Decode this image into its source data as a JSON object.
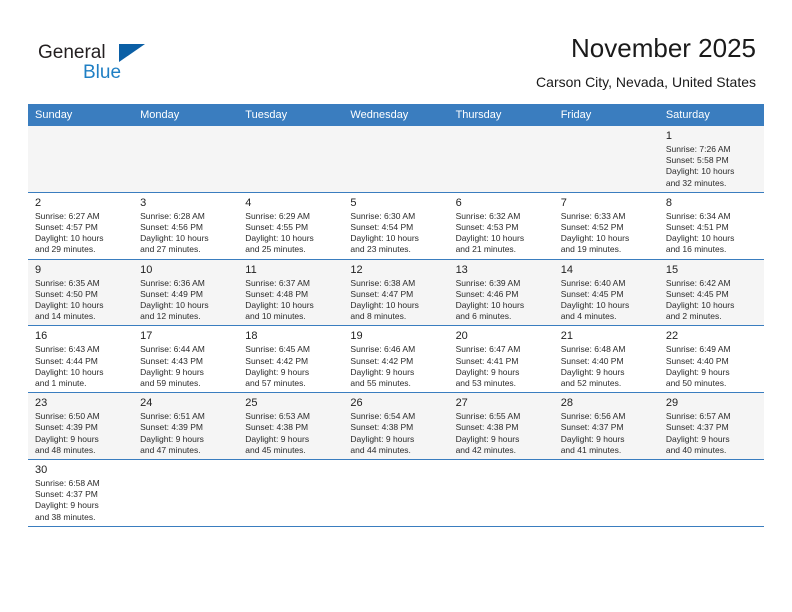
{
  "brand": {
    "name_top": "General",
    "name_bottom": "Blue",
    "accent_color": "#0b5fa5",
    "text_color": "#231f20",
    "blue_text_color": "#1f7fc4",
    "triangle_icon": "triangle-icon"
  },
  "header": {
    "title": "November 2025",
    "location": "Carson City, Nevada, United States"
  },
  "theme": {
    "header_row_bg": "#3a7dbf",
    "header_row_text": "#ffffff",
    "alt_row_bg": "#f5f5f5",
    "row_divider": "#3a7dbf"
  },
  "weekdays": [
    "Sunday",
    "Monday",
    "Tuesday",
    "Wednesday",
    "Thursday",
    "Friday",
    "Saturday"
  ],
  "labels": {
    "sunrise_prefix": "Sunrise:",
    "sunset_prefix": "Sunset:",
    "daylight_prefix": "Daylight:"
  },
  "weeks": [
    [
      {
        "empty": true
      },
      {
        "empty": true
      },
      {
        "empty": true
      },
      {
        "empty": true
      },
      {
        "empty": true
      },
      {
        "empty": true
      },
      {
        "day": "1",
        "sunrise": "Sunrise: 7:26 AM",
        "sunset": "Sunset: 5:58 PM",
        "daylight_line1": "Daylight: 10 hours",
        "daylight_line2": "and 32 minutes."
      }
    ],
    [
      {
        "day": "2",
        "sunrise": "Sunrise: 6:27 AM",
        "sunset": "Sunset: 4:57 PM",
        "daylight_line1": "Daylight: 10 hours",
        "daylight_line2": "and 29 minutes."
      },
      {
        "day": "3",
        "sunrise": "Sunrise: 6:28 AM",
        "sunset": "Sunset: 4:56 PM",
        "daylight_line1": "Daylight: 10 hours",
        "daylight_line2": "and 27 minutes."
      },
      {
        "day": "4",
        "sunrise": "Sunrise: 6:29 AM",
        "sunset": "Sunset: 4:55 PM",
        "daylight_line1": "Daylight: 10 hours",
        "daylight_line2": "and 25 minutes."
      },
      {
        "day": "5",
        "sunrise": "Sunrise: 6:30 AM",
        "sunset": "Sunset: 4:54 PM",
        "daylight_line1": "Daylight: 10 hours",
        "daylight_line2": "and 23 minutes."
      },
      {
        "day": "6",
        "sunrise": "Sunrise: 6:32 AM",
        "sunset": "Sunset: 4:53 PM",
        "daylight_line1": "Daylight: 10 hours",
        "daylight_line2": "and 21 minutes."
      },
      {
        "day": "7",
        "sunrise": "Sunrise: 6:33 AM",
        "sunset": "Sunset: 4:52 PM",
        "daylight_line1": "Daylight: 10 hours",
        "daylight_line2": "and 19 minutes."
      },
      {
        "day": "8",
        "sunrise": "Sunrise: 6:34 AM",
        "sunset": "Sunset: 4:51 PM",
        "daylight_line1": "Daylight: 10 hours",
        "daylight_line2": "and 16 minutes."
      }
    ],
    [
      {
        "day": "9",
        "sunrise": "Sunrise: 6:35 AM",
        "sunset": "Sunset: 4:50 PM",
        "daylight_line1": "Daylight: 10 hours",
        "daylight_line2": "and 14 minutes."
      },
      {
        "day": "10",
        "sunrise": "Sunrise: 6:36 AM",
        "sunset": "Sunset: 4:49 PM",
        "daylight_line1": "Daylight: 10 hours",
        "daylight_line2": "and 12 minutes."
      },
      {
        "day": "11",
        "sunrise": "Sunrise: 6:37 AM",
        "sunset": "Sunset: 4:48 PM",
        "daylight_line1": "Daylight: 10 hours",
        "daylight_line2": "and 10 minutes."
      },
      {
        "day": "12",
        "sunrise": "Sunrise: 6:38 AM",
        "sunset": "Sunset: 4:47 PM",
        "daylight_line1": "Daylight: 10 hours",
        "daylight_line2": "and 8 minutes."
      },
      {
        "day": "13",
        "sunrise": "Sunrise: 6:39 AM",
        "sunset": "Sunset: 4:46 PM",
        "daylight_line1": "Daylight: 10 hours",
        "daylight_line2": "and 6 minutes."
      },
      {
        "day": "14",
        "sunrise": "Sunrise: 6:40 AM",
        "sunset": "Sunset: 4:45 PM",
        "daylight_line1": "Daylight: 10 hours",
        "daylight_line2": "and 4 minutes."
      },
      {
        "day": "15",
        "sunrise": "Sunrise: 6:42 AM",
        "sunset": "Sunset: 4:45 PM",
        "daylight_line1": "Daylight: 10 hours",
        "daylight_line2": "and 2 minutes."
      }
    ],
    [
      {
        "day": "16",
        "sunrise": "Sunrise: 6:43 AM",
        "sunset": "Sunset: 4:44 PM",
        "daylight_line1": "Daylight: 10 hours",
        "daylight_line2": "and 1 minute."
      },
      {
        "day": "17",
        "sunrise": "Sunrise: 6:44 AM",
        "sunset": "Sunset: 4:43 PM",
        "daylight_line1": "Daylight: 9 hours",
        "daylight_line2": "and 59 minutes."
      },
      {
        "day": "18",
        "sunrise": "Sunrise: 6:45 AM",
        "sunset": "Sunset: 4:42 PM",
        "daylight_line1": "Daylight: 9 hours",
        "daylight_line2": "and 57 minutes."
      },
      {
        "day": "19",
        "sunrise": "Sunrise: 6:46 AM",
        "sunset": "Sunset: 4:42 PM",
        "daylight_line1": "Daylight: 9 hours",
        "daylight_line2": "and 55 minutes."
      },
      {
        "day": "20",
        "sunrise": "Sunrise: 6:47 AM",
        "sunset": "Sunset: 4:41 PM",
        "daylight_line1": "Daylight: 9 hours",
        "daylight_line2": "and 53 minutes."
      },
      {
        "day": "21",
        "sunrise": "Sunrise: 6:48 AM",
        "sunset": "Sunset: 4:40 PM",
        "daylight_line1": "Daylight: 9 hours",
        "daylight_line2": "and 52 minutes."
      },
      {
        "day": "22",
        "sunrise": "Sunrise: 6:49 AM",
        "sunset": "Sunset: 4:40 PM",
        "daylight_line1": "Daylight: 9 hours",
        "daylight_line2": "and 50 minutes."
      }
    ],
    [
      {
        "day": "23",
        "sunrise": "Sunrise: 6:50 AM",
        "sunset": "Sunset: 4:39 PM",
        "daylight_line1": "Daylight: 9 hours",
        "daylight_line2": "and 48 minutes."
      },
      {
        "day": "24",
        "sunrise": "Sunrise: 6:51 AM",
        "sunset": "Sunset: 4:39 PM",
        "daylight_line1": "Daylight: 9 hours",
        "daylight_line2": "and 47 minutes."
      },
      {
        "day": "25",
        "sunrise": "Sunrise: 6:53 AM",
        "sunset": "Sunset: 4:38 PM",
        "daylight_line1": "Daylight: 9 hours",
        "daylight_line2": "and 45 minutes."
      },
      {
        "day": "26",
        "sunrise": "Sunrise: 6:54 AM",
        "sunset": "Sunset: 4:38 PM",
        "daylight_line1": "Daylight: 9 hours",
        "daylight_line2": "and 44 minutes."
      },
      {
        "day": "27",
        "sunrise": "Sunrise: 6:55 AM",
        "sunset": "Sunset: 4:38 PM",
        "daylight_line1": "Daylight: 9 hours",
        "daylight_line2": "and 42 minutes."
      },
      {
        "day": "28",
        "sunrise": "Sunrise: 6:56 AM",
        "sunset": "Sunset: 4:37 PM",
        "daylight_line1": "Daylight: 9 hours",
        "daylight_line2": "and 41 minutes."
      },
      {
        "day": "29",
        "sunrise": "Sunrise: 6:57 AM",
        "sunset": "Sunset: 4:37 PM",
        "daylight_line1": "Daylight: 9 hours",
        "daylight_line2": "and 40 minutes."
      }
    ],
    [
      {
        "day": "30",
        "sunrise": "Sunrise: 6:58 AM",
        "sunset": "Sunset: 4:37 PM",
        "daylight_line1": "Daylight: 9 hours",
        "daylight_line2": "and 38 minutes."
      },
      {
        "empty": true
      },
      {
        "empty": true
      },
      {
        "empty": true
      },
      {
        "empty": true
      },
      {
        "empty": true
      },
      {
        "empty": true
      }
    ]
  ]
}
